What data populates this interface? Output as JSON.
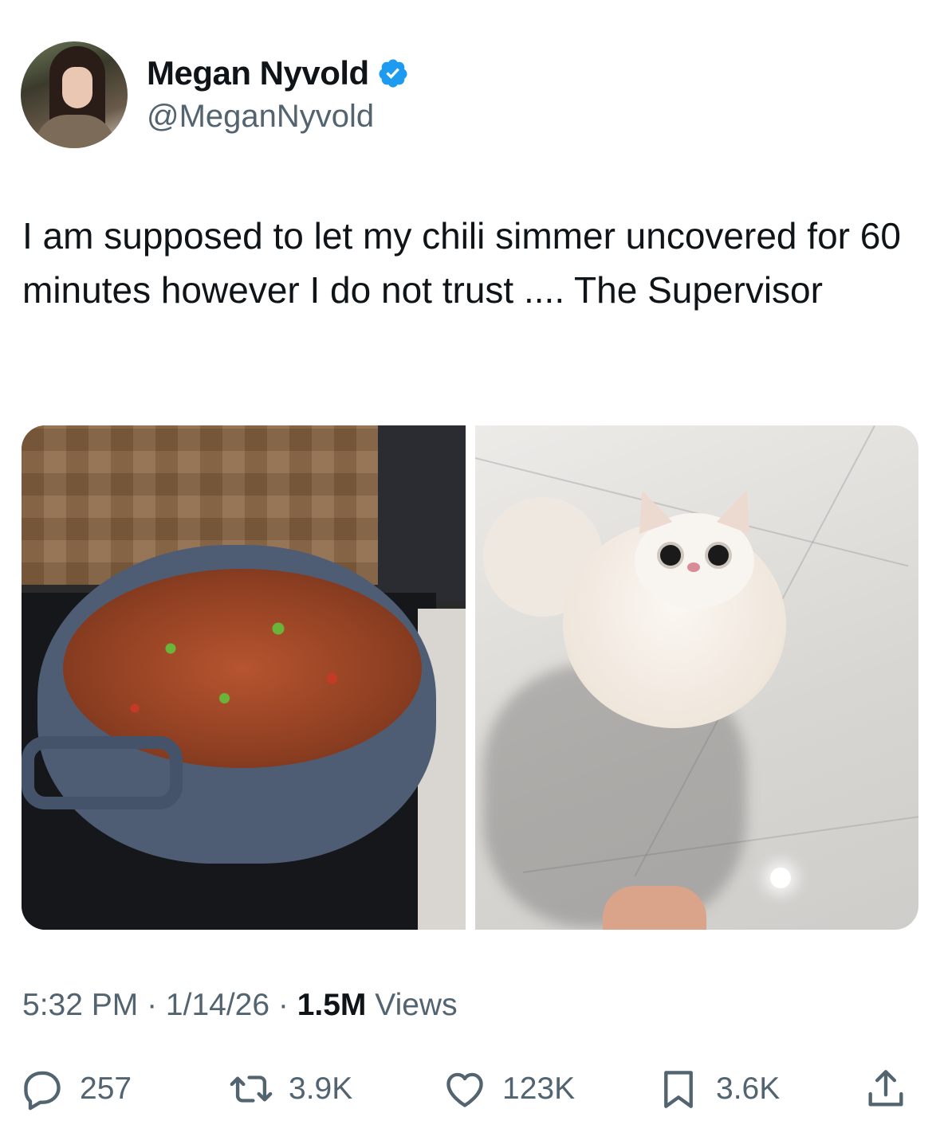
{
  "author": {
    "display_name": "Megan Nyvold",
    "handle": "@MeganNyvold",
    "verified": true,
    "verified_color": "#1d9bf0"
  },
  "tweet": {
    "text": "I am supposed to let my chili simmer uncovered for 60 minutes however I do not trust .... The Supervisor"
  },
  "meta": {
    "time": "5:32 PM",
    "sep1": " · ",
    "date": "1/14/26",
    "sep2": " · ",
    "views_count": "1.5M",
    "views_label": " Views"
  },
  "actions": {
    "replies": "257",
    "reposts": "3.9K",
    "likes": "123K",
    "bookmarks": "3.6K"
  },
  "icons": {
    "reply": "reply-icon",
    "repost": "repost-icon",
    "like": "heart-icon",
    "bookmark": "bookmark-icon",
    "share": "share-icon"
  },
  "colors": {
    "text_primary": "#0f1419",
    "text_secondary": "#536471"
  }
}
